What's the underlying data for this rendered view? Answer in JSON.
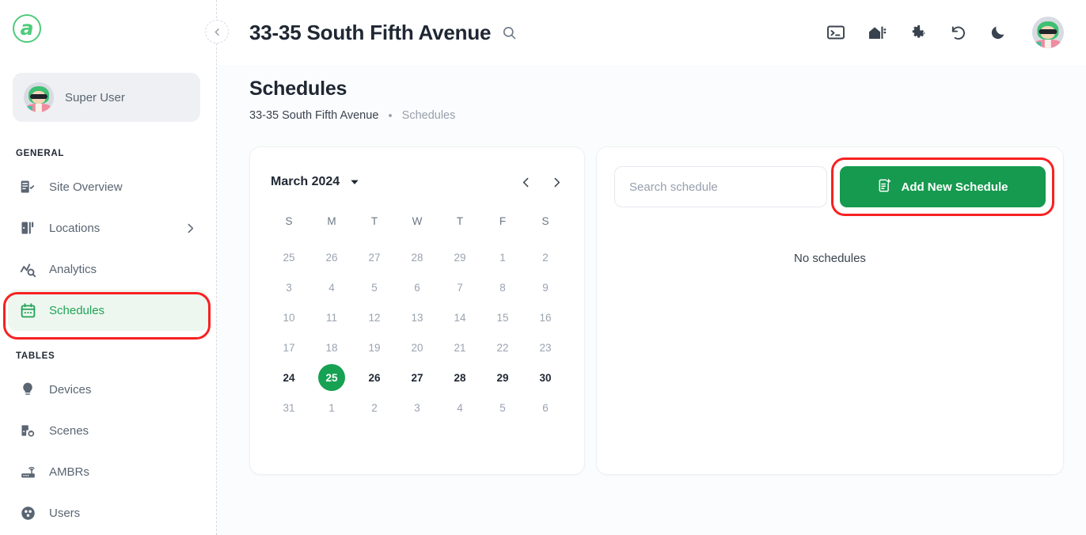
{
  "brand": {
    "logo_letter": "a",
    "accent_green": "#17a153",
    "logo_green": "#4ecb7c",
    "annotation_red": "#f72121"
  },
  "sidebar": {
    "user": {
      "name": "Super User",
      "avatar": "user-avatar"
    },
    "collapse_button": "collapse-sidebar",
    "sections": [
      {
        "label": "GENERAL",
        "items": [
          {
            "label": "Site Overview",
            "icon": "site-overview-icon",
            "active": false,
            "has_chevron": false
          },
          {
            "label": "Locations",
            "icon": "locations-icon",
            "active": false,
            "has_chevron": true
          },
          {
            "label": "Analytics",
            "icon": "analytics-icon",
            "active": false,
            "has_chevron": false
          },
          {
            "label": "Schedules",
            "icon": "calendar-icon",
            "active": true,
            "has_chevron": false
          }
        ]
      },
      {
        "label": "TABLES",
        "items": [
          {
            "label": "Devices",
            "icon": "bulb-icon",
            "active": false,
            "has_chevron": false
          },
          {
            "label": "Scenes",
            "icon": "scenes-icon",
            "active": false,
            "has_chevron": false
          },
          {
            "label": "AMBRs",
            "icon": "router-icon",
            "active": false,
            "has_chevron": false
          },
          {
            "label": "Users",
            "icon": "users-icon",
            "active": false,
            "has_chevron": false
          }
        ]
      }
    ]
  },
  "topbar": {
    "title": "33-35 South Fifth Avenue",
    "search_icon": "search-icon",
    "actions": [
      {
        "name": "terminal-icon"
      },
      {
        "name": "building-export-icon"
      },
      {
        "name": "gear-icon"
      },
      {
        "name": "refresh-icon"
      },
      {
        "name": "dark-mode-icon"
      }
    ],
    "avatar": "account-avatar"
  },
  "page": {
    "heading": "Schedules",
    "breadcrumb": {
      "first": "33-35 South Fifth Avenue",
      "separator": "•",
      "current": "Schedules"
    }
  },
  "calendar": {
    "month_label": "March 2024",
    "dropdown_icon": "chevron-down-icon",
    "prev_icon": "chevron-left-icon",
    "next_icon": "chevron-right-icon",
    "day_headers": [
      "S",
      "M",
      "T",
      "W",
      "T",
      "F",
      "S"
    ],
    "selected_day": 25,
    "weeks": [
      [
        {
          "d": "25",
          "muted": true
        },
        {
          "d": "26",
          "muted": true
        },
        {
          "d": "27",
          "muted": true
        },
        {
          "d": "28",
          "muted": true
        },
        {
          "d": "29",
          "muted": true
        },
        {
          "d": "1",
          "muted": true
        },
        {
          "d": "2",
          "muted": true
        }
      ],
      [
        {
          "d": "3",
          "muted": true
        },
        {
          "d": "4",
          "muted": true
        },
        {
          "d": "5",
          "muted": true
        },
        {
          "d": "6",
          "muted": true
        },
        {
          "d": "7",
          "muted": true
        },
        {
          "d": "8",
          "muted": true
        },
        {
          "d": "9",
          "muted": true
        }
      ],
      [
        {
          "d": "10",
          "muted": true
        },
        {
          "d": "11",
          "muted": true
        },
        {
          "d": "12",
          "muted": true
        },
        {
          "d": "13",
          "muted": true
        },
        {
          "d": "14",
          "muted": true
        },
        {
          "d": "15",
          "muted": true
        },
        {
          "d": "16",
          "muted": true
        }
      ],
      [
        {
          "d": "17",
          "muted": true
        },
        {
          "d": "18",
          "muted": true
        },
        {
          "d": "19",
          "muted": true
        },
        {
          "d": "20",
          "muted": true
        },
        {
          "d": "21",
          "muted": true
        },
        {
          "d": "22",
          "muted": true
        },
        {
          "d": "23",
          "muted": true
        }
      ],
      [
        {
          "d": "24",
          "muted": false
        },
        {
          "d": "25",
          "muted": false,
          "selected": true
        },
        {
          "d": "26",
          "muted": false
        },
        {
          "d": "27",
          "muted": false
        },
        {
          "d": "28",
          "muted": false
        },
        {
          "d": "29",
          "muted": false
        },
        {
          "d": "30",
          "muted": false
        }
      ],
      [
        {
          "d": "31",
          "muted": true
        },
        {
          "d": "1",
          "muted": true
        },
        {
          "d": "2",
          "muted": true
        },
        {
          "d": "3",
          "muted": true
        },
        {
          "d": "4",
          "muted": true
        },
        {
          "d": "5",
          "muted": true
        },
        {
          "d": "6",
          "muted": true
        }
      ]
    ]
  },
  "schedules_panel": {
    "search_placeholder": "Search schedule",
    "search_value": "",
    "add_button_label": "Add New Schedule",
    "add_button_icon": "add-document-icon",
    "empty_message": "No schedules"
  }
}
